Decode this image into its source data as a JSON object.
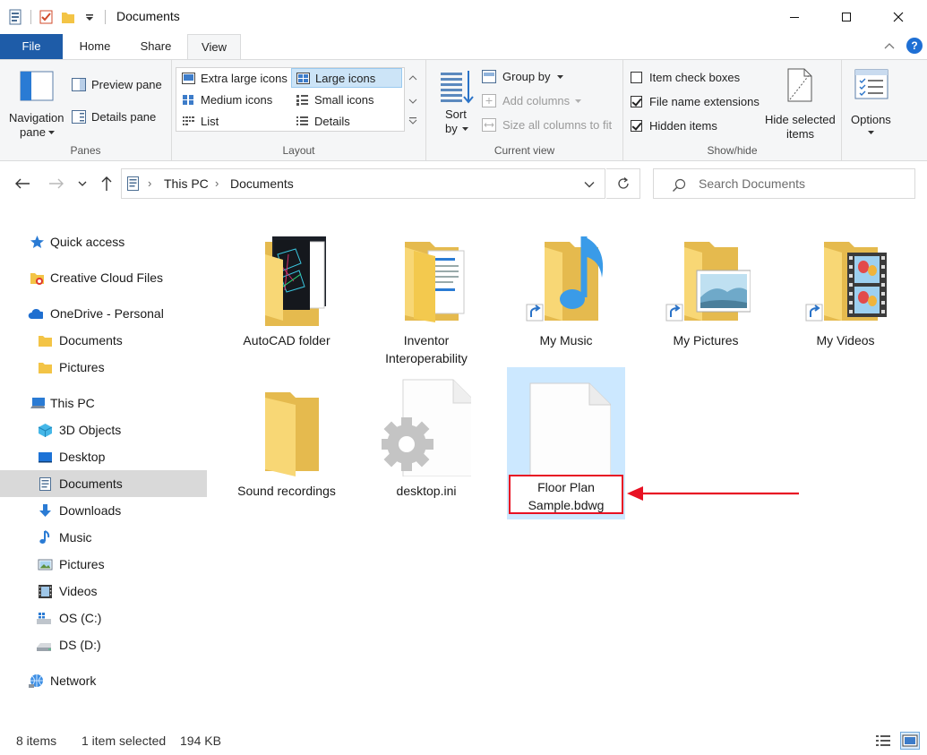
{
  "window": {
    "title": "Documents"
  },
  "tabs": {
    "file": "File",
    "home": "Home",
    "share": "Share",
    "view": "View",
    "help": "?"
  },
  "ribbon": {
    "panes": {
      "label": "Panes",
      "navigation_pane_line1": "Navigation",
      "navigation_pane_line2": "pane",
      "preview_pane": "Preview pane",
      "details_pane": "Details pane"
    },
    "layout": {
      "label": "Layout",
      "items": [
        "Extra large icons",
        "Large icons",
        "Medium icons",
        "Small icons",
        "List",
        "Details"
      ],
      "selected": "Large icons"
    },
    "current_view": {
      "label": "Current view",
      "sort_line1": "Sort",
      "sort_line2": "by",
      "group_by": "Group by",
      "add_columns": "Add columns",
      "size_all_columns": "Size all columns to fit"
    },
    "show_hide": {
      "label": "Show/hide",
      "item_check_boxes": "Item check boxes",
      "file_name_extensions": "File name extensions",
      "hidden_items": "Hidden items",
      "hide_selected_line1": "Hide selected",
      "hide_selected_line2": "items"
    },
    "options": {
      "label": "Options"
    }
  },
  "address": {
    "crumbs": [
      "This PC",
      "Documents"
    ]
  },
  "search": {
    "placeholder": "Search Documents"
  },
  "nav": {
    "quick_access": "Quick access",
    "creative_cloud": "Creative Cloud Files",
    "onedrive": "OneDrive - Personal",
    "od_documents": "Documents",
    "od_pictures": "Pictures",
    "this_pc": "This PC",
    "objects3d": "3D Objects",
    "desktop": "Desktop",
    "documents": "Documents",
    "downloads": "Downloads",
    "music": "Music",
    "pictures": "Pictures",
    "videos": "Videos",
    "os_c": "OS (C:)",
    "ds_d": "DS (D:)",
    "network": "Network"
  },
  "files": {
    "autocad": "AutoCAD folder",
    "inventor_line1": "Inventor",
    "inventor_line2": "Interoperability",
    "my_music": "My Music",
    "my_pictures": "My Pictures",
    "my_videos": "My Videos",
    "sound_recordings": "Sound recordings",
    "desktop_ini": "desktop.ini",
    "floor_plan_line1": "Floor Plan",
    "floor_plan_line2": "Sample.bdwg"
  },
  "status": {
    "items": "8 items",
    "selected": "1 item selected",
    "size": "194 KB"
  },
  "colors": {
    "accent": "#1e5ca8",
    "selection": "#cce8ff",
    "annotation": "#e81123",
    "folder": "#f8d775"
  }
}
